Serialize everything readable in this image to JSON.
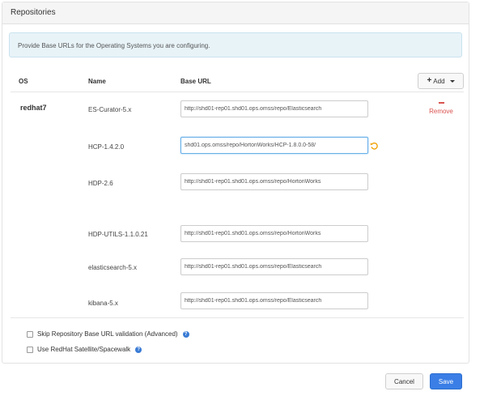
{
  "panel": {
    "title": "Repositories"
  },
  "alert": {
    "text": "Provide Base URLs for the Operating Systems you are configuring."
  },
  "table": {
    "headers": {
      "os": "OS",
      "name": "Name",
      "base_url": "Base URL"
    },
    "add_button": {
      "label": "Add",
      "icon": "plus-icon"
    }
  },
  "os": {
    "name": "redhat7",
    "remove_label": "Remove",
    "repos": [
      {
        "name": "ES-Curator-5.x",
        "base_url": "http://shd01-rep01.shd01.ops.omss/repo/Elasticsearch"
      },
      {
        "name": "HCP-1.4.2.0",
        "base_url": "shd01.ops.omss/repo/HortonWorks/HCP-1.8.0.0-58/"
      },
      {
        "name": "HDP-2.6",
        "base_url": "http://shd01-rep01.shd01.ops.omss/repo/HortonWorks"
      },
      {
        "name": "HDP-UTILS-1.1.0.21",
        "base_url": "http://shd01-rep01.shd01.ops.omss/repo/HortonWorks"
      },
      {
        "name": "elasticsearch-5.x",
        "base_url": "http://shd01-rep01.shd01.ops.omss/repo/Elasticsearch"
      },
      {
        "name": "kibana-5.x",
        "base_url": "http://shd01-rep01.shd01.ops.omss/repo/Elasticsearch"
      }
    ]
  },
  "options": {
    "skip_validation": {
      "label": "Skip Repository Base URL validation (Advanced)",
      "checked": false
    },
    "use_satellite": {
      "label": "Use RedHat Satellite/Spacewalk",
      "checked": false
    }
  },
  "footer": {
    "cancel_label": "Cancel",
    "save_label": "Save"
  },
  "colors": {
    "primary": "#3a7ee6",
    "danger": "#d9534f",
    "alert_bg": "#e8f3f8",
    "undo": "#f0a000"
  }
}
